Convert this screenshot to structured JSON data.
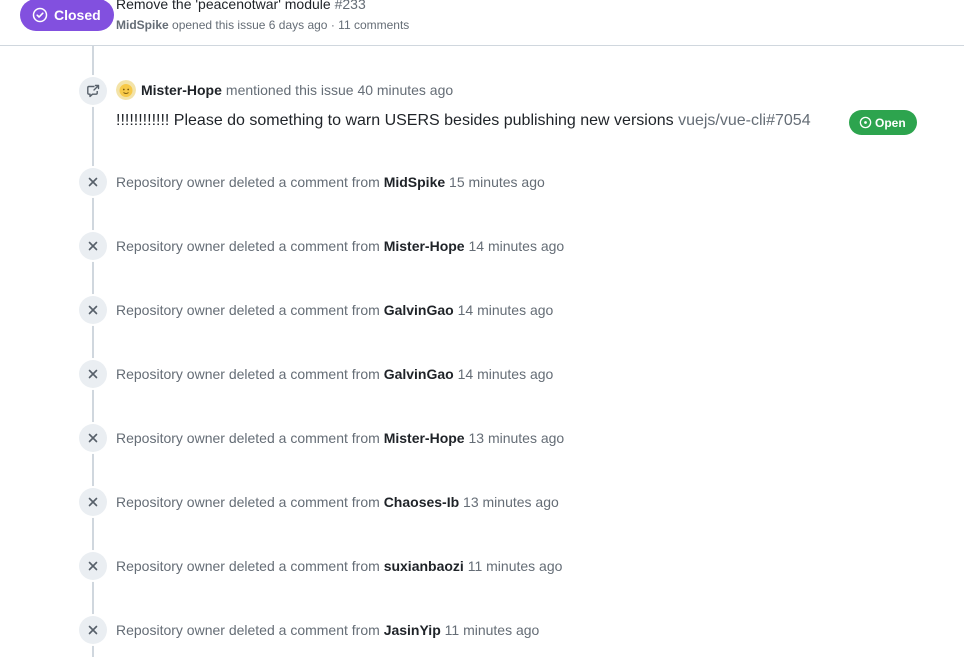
{
  "issue": {
    "state_label": "Closed",
    "title": "Remove the 'peacenotwar' module",
    "number": "#233",
    "author": "MidSpike",
    "opened_text": "opened this issue 6 days ago",
    "separator": "·",
    "comments_text": "11 comments"
  },
  "mention": {
    "user": "Mister-Hope",
    "action_text": "mentioned this issue",
    "time": "40 minutes ago",
    "ref_title": "!!!!!!!!!!!! Please do something to warn USERS besides publishing new versions",
    "ref_repo": "vuejs/vue-cli#7054",
    "ref_state": "Open"
  },
  "deleted_prefix": "Repository owner deleted a comment from",
  "deleted_events": [
    {
      "user": "MidSpike",
      "time": "15 minutes ago"
    },
    {
      "user": "Mister-Hope",
      "time": "14 minutes ago"
    },
    {
      "user": "GalvinGao",
      "time": "14 minutes ago"
    },
    {
      "user": "GalvinGao",
      "time": "14 minutes ago"
    },
    {
      "user": "Mister-Hope",
      "time": "13 minutes ago"
    },
    {
      "user": "Chaoses-Ib",
      "time": "13 minutes ago"
    },
    {
      "user": "suxianbaozi",
      "time": "11 minutes ago"
    },
    {
      "user": "JasinYip",
      "time": "11 minutes ago"
    }
  ],
  "icons": {
    "state": "issue-closed-icon",
    "mention": "cross-reference-icon",
    "deleted": "x-icon",
    "ref_state": "issue-opened-icon"
  },
  "colors": {
    "closed": "#8250df",
    "open": "#2da44e",
    "muted_text": "#656d76",
    "text": "#1f2328",
    "icon_bg": "#eaeef2",
    "line": "#d0d7de"
  }
}
